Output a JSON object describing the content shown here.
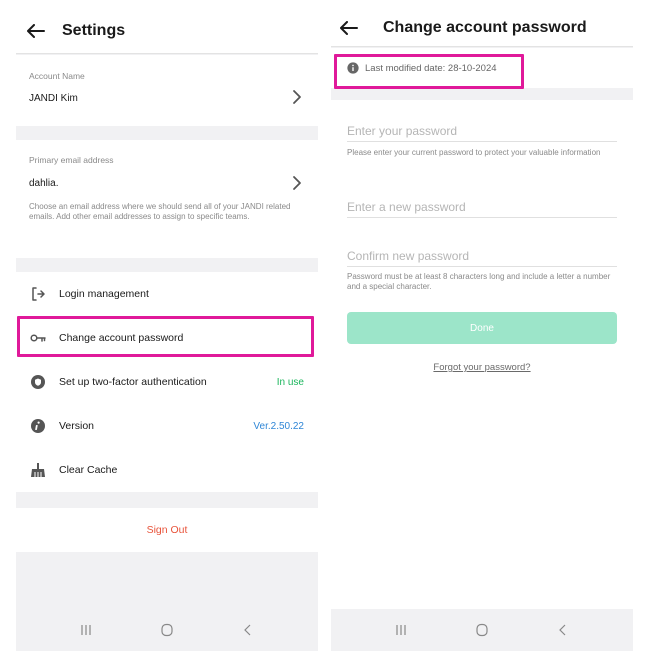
{
  "settings": {
    "title": "Settings",
    "account_name_label": "Account Name",
    "account_name_value": "JANDI Kim",
    "email_label": "Primary email address",
    "email_value": "dahlia.",
    "email_help": "Choose an email address where we should send all of your JANDI related emails. Add other email addresses to assign to specific teams.",
    "menu": [
      {
        "label": "Login management",
        "icon": "login-icon"
      },
      {
        "label": "Change account password",
        "icon": "key-icon"
      },
      {
        "label": "Set up two-factor authentication",
        "icon": "shield-icon",
        "value": "In use",
        "value_color": "#1bb55c"
      },
      {
        "label": "Version",
        "icon": "info-icon",
        "value": "Ver.2.50.22",
        "value_color": "#2f86d6"
      },
      {
        "label": "Clear Cache",
        "icon": "broom-icon"
      }
    ],
    "sign_out": "Sign Out"
  },
  "password": {
    "title": "Change account password",
    "last_modified": "Last modified date: 28-10-2024",
    "current_placeholder": "Enter your password",
    "current_help": "Please enter your current password to protect your valuable information",
    "new_placeholder": "Enter a new password",
    "confirm_placeholder": "Confirm new password",
    "rules_help": "Password must be at least 8 characters long and include a letter a number and a special character.",
    "done_label": "Done",
    "forgot_label": "Forgot your password?"
  },
  "colors": {
    "highlight": "#e0199a",
    "done_button": "#9ce5c9",
    "sign_out": "#e8533a",
    "in_use": "#1bb55c",
    "version": "#2f86d6"
  }
}
